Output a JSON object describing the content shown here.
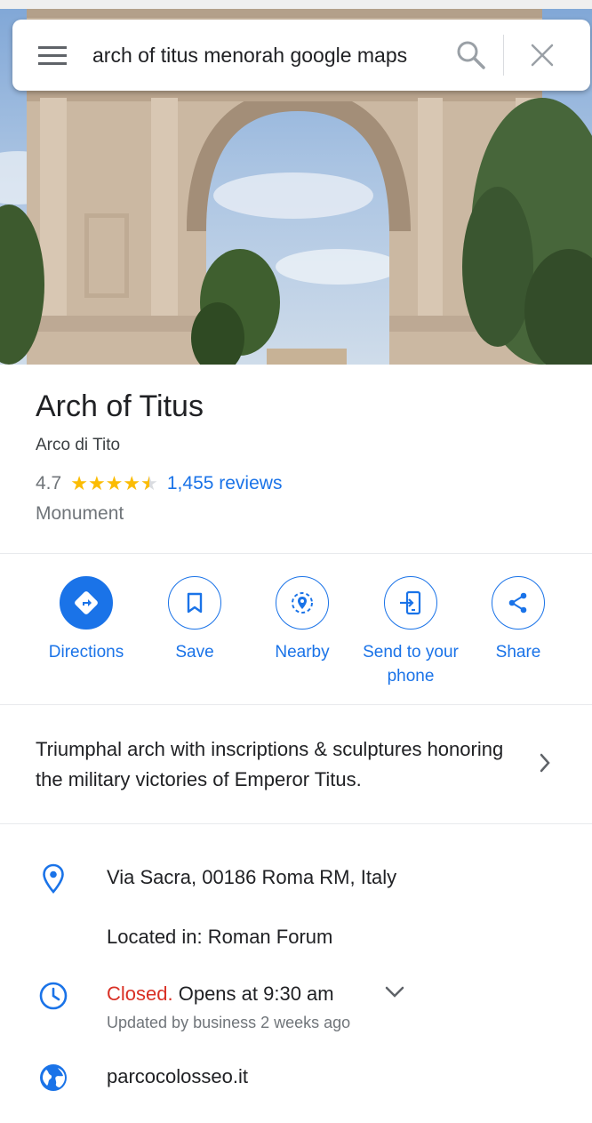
{
  "search": {
    "query": "arch of titus menorah google maps",
    "menu_icon": "hamburger-menu-icon",
    "search_icon": "search-icon",
    "clear_icon": "close-icon"
  },
  "place": {
    "title": "Arch of Titus",
    "subtitle": "Arco di Tito",
    "rating": "4.7",
    "stars": 4.7,
    "reviews": "1,455 reviews",
    "category": "Monument"
  },
  "actions": [
    {
      "label": "Directions",
      "icon": "directions-icon"
    },
    {
      "label": "Save",
      "icon": "bookmark-icon"
    },
    {
      "label": "Nearby",
      "icon": "nearby-icon"
    },
    {
      "label": "Send to your phone",
      "icon": "send-to-phone-icon"
    },
    {
      "label": "Share",
      "icon": "share-icon"
    }
  ],
  "description": "Triumphal arch with inscriptions & sculptures honoring the military victories of Emperor Titus.",
  "details": {
    "address": "Via Sacra, 00186 Roma RM, Italy",
    "located_in": "Located in: Roman Forum",
    "hours_status": "Closed.",
    "hours_open": "Opens at 9:30 am",
    "hours_updated": "Updated by business 2 weeks ago",
    "website": "parcocolosseo.it"
  },
  "colors": {
    "accent": "#1a73e8",
    "star": "#fbbc04",
    "closed": "#d93025",
    "secondary_text": "#70757a"
  }
}
